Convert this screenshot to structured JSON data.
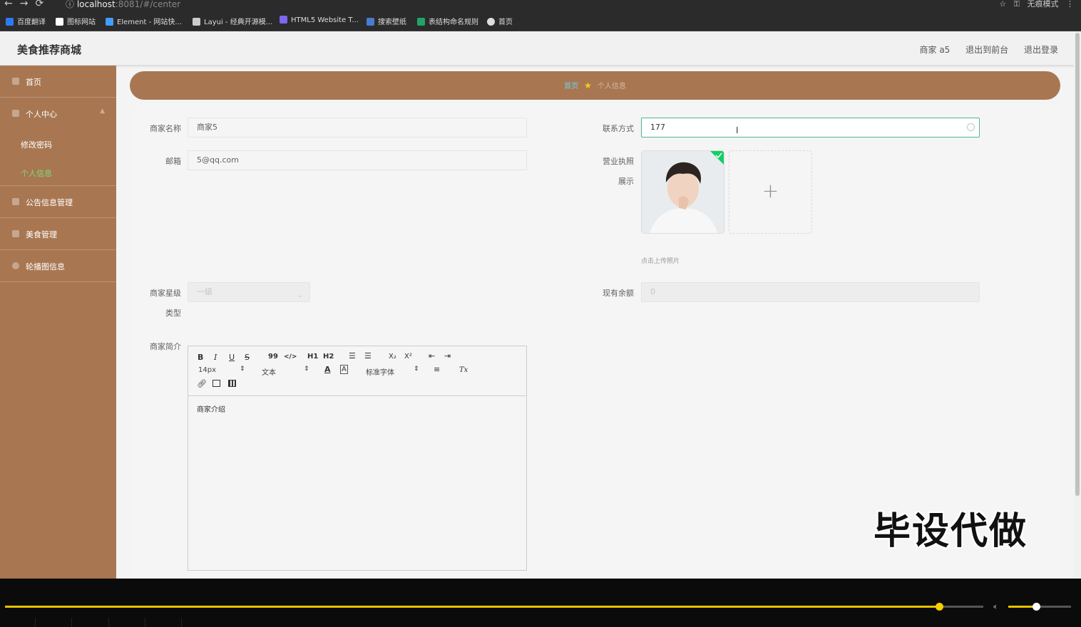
{
  "browser": {
    "url_host": "localhost",
    "url_path": ":8081/#/center",
    "profile_label": "无痕模式",
    "bookmarks": [
      {
        "label": "百度翻译",
        "color": "#2d7bf4"
      },
      {
        "label": "图标网站",
        "color": "#ffffff"
      },
      {
        "label": "Element - 网站快...",
        "color": "#409eff"
      },
      {
        "label": "Layui - 经典开源模...",
        "color": "#cccccc"
      },
      {
        "label": "HTML5 Website T...",
        "color": "#7b68ee"
      },
      {
        "label": "搜索壁纸",
        "color": "#4a7bd1"
      },
      {
        "label": "表结构命名规则",
        "color": "#21a366"
      },
      {
        "label": "首页",
        "color": "#dddddd"
      }
    ]
  },
  "header": {
    "brand": "美食推荐商城",
    "user": "商家 a5",
    "to_front": "退出到前台",
    "logout": "退出登录"
  },
  "sidebar": {
    "home": "首页",
    "personal_center": "个人中心",
    "change_password": "修改密码",
    "personal_info": "个人信息",
    "notice_manage": "公告信息管理",
    "food_manage": "美食管理",
    "carousel_info": "轮播图信息"
  },
  "breadcrumb": {
    "home": "首页",
    "current": "个人信息"
  },
  "form": {
    "shop_name_label": "商家名称",
    "shop_name_value": "商家5",
    "contact_label": "联系方式",
    "contact_value": "177",
    "email_label": "邮箱",
    "email_value": "5@qq.com",
    "license_label_1": "营业执照",
    "license_label_2": "展示",
    "upload_tip": "点击上传照片",
    "upload_plus": "+",
    "level_label_1": "商家星级",
    "level_label_2": "类型",
    "level_value": "一级",
    "balance_label": "现有余额",
    "balance_value": "0",
    "intro_label": "商家简介",
    "intro_value": "商家介绍"
  },
  "editor": {
    "bold": "B",
    "italic": "I",
    "underline": "U",
    "strike": "S",
    "quote": "99",
    "code": "</>",
    "h1": "H1",
    "h2": "H2",
    "sub": "X₂",
    "sup": "X²",
    "size": "14px",
    "text_type": "文本",
    "font": "标准字体",
    "clear": "Tx"
  },
  "watermark": "毕设代做",
  "player": {
    "progress": 0.955,
    "volume": 0.44
  }
}
